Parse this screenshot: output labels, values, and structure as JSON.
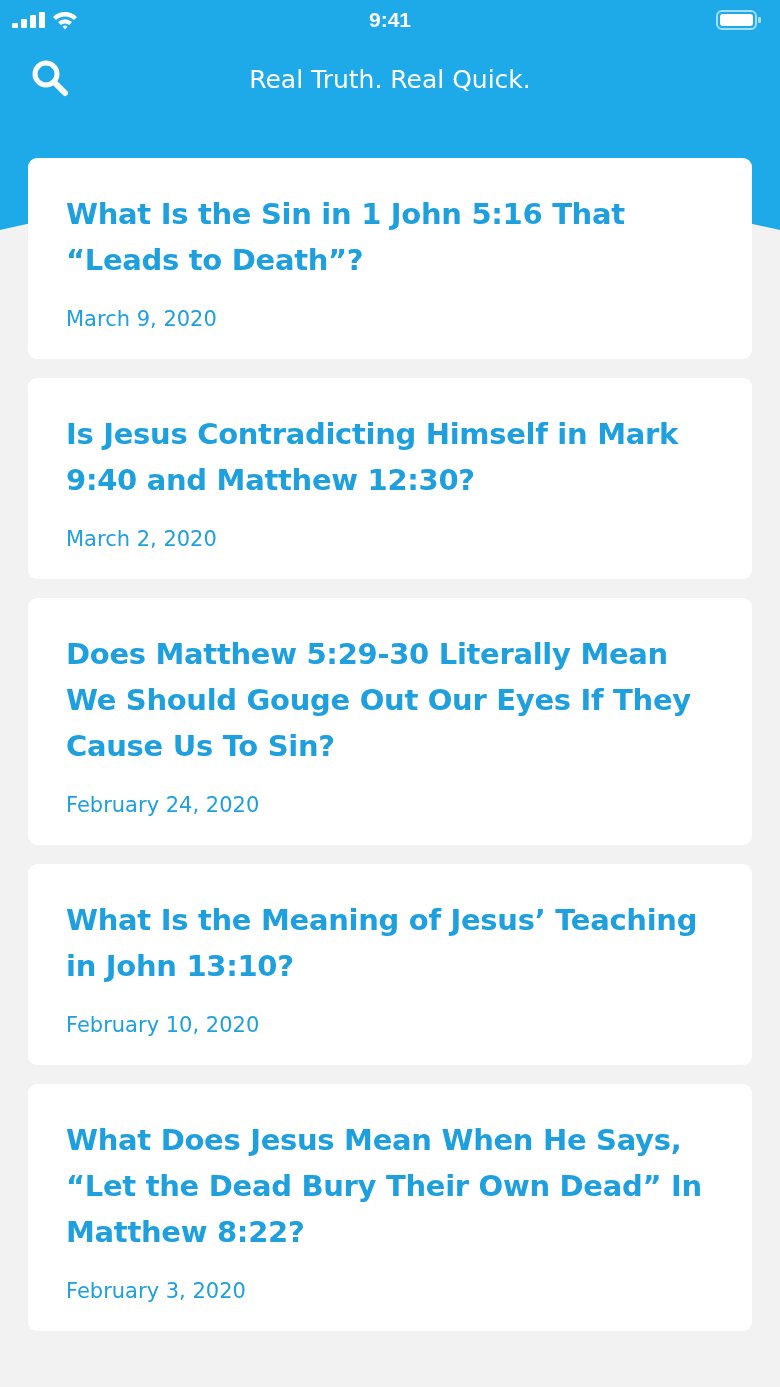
{
  "status_bar": {
    "time": "9:41"
  },
  "header": {
    "title": "Real Truth. Real Quick."
  },
  "articles": [
    {
      "title": "What Is the Sin in 1 John 5:16 That “Leads to Death”?",
      "date": "March 9, 2020"
    },
    {
      "title": "Is Jesus Contradicting Himself in Mark 9:40 and Matthew 12:30?",
      "date": "March 2, 2020"
    },
    {
      "title": "Does Matthew 5:29-30 Literally Mean We Should Gouge Out Our Eyes If They Cause Us To Sin?",
      "date": "February 24, 2020"
    },
    {
      "title": "What Is the Meaning of Jesus’ Teaching in John 13:10?",
      "date": "February 10, 2020"
    },
    {
      "title": "What Does Jesus Mean When He Says, “Let the Dead Bury Their Own Dead” In Matthew 8:22?",
      "date": "February 3, 2020"
    }
  ]
}
